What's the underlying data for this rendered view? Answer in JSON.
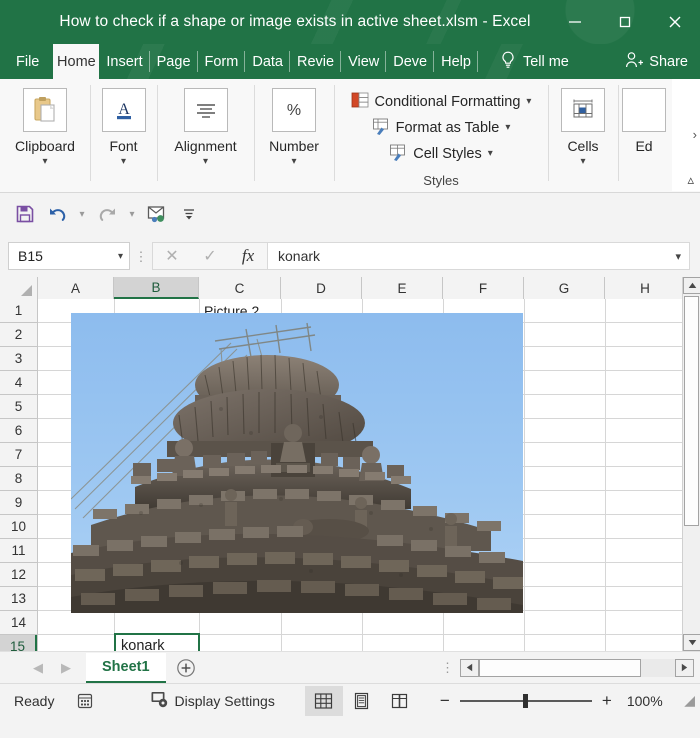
{
  "window": {
    "title": "How to check if a shape or image exists in active sheet.xlsm  -  Excel",
    "accent_green": "#217346",
    "controls": [
      {
        "name": "minimize",
        "glyph": "minimize-icon"
      },
      {
        "name": "maximize",
        "glyph": "maximize-icon"
      },
      {
        "name": "close",
        "glyph": "close-icon"
      }
    ]
  },
  "ribbon": {
    "tabs": [
      {
        "label": "File",
        "active": false
      },
      {
        "label": "Home",
        "active": true
      },
      {
        "label": "Insert",
        "active": false
      },
      {
        "label": "Page",
        "active": false
      },
      {
        "label": "Form",
        "active": false
      },
      {
        "label": "Data",
        "active": false
      },
      {
        "label": "Revie",
        "active": false
      },
      {
        "label": "View",
        "active": false
      },
      {
        "label": "Deve",
        "active": false
      },
      {
        "label": "Help",
        "active": false
      }
    ],
    "tell_me": "Tell me",
    "share": "Share",
    "groups": [
      {
        "label": "Clipboard",
        "icon": "clipboard-icon"
      },
      {
        "label": "Font",
        "icon": "font-a-icon"
      },
      {
        "label": "Alignment",
        "icon": "alignment-icon"
      },
      {
        "label": "Number",
        "icon": "percent-icon"
      }
    ],
    "styles": {
      "caption": "Styles",
      "items": [
        {
          "label": "Conditional Formatting",
          "icon": "conditional-formatting-icon"
        },
        {
          "label": "Format as Table",
          "icon": "format-as-table-icon"
        },
        {
          "label": "Cell Styles",
          "icon": "cell-styles-icon"
        }
      ]
    },
    "cells_group": {
      "label": "Cells",
      "icon": "cells-icon"
    },
    "editing_group": {
      "label": "Ed"
    }
  },
  "quick_access": [
    {
      "name": "save-icon"
    },
    {
      "name": "undo-icon"
    },
    {
      "name": "redo-icon"
    },
    {
      "name": "send-to-recipient-icon"
    },
    {
      "name": "customize-qat-icon"
    }
  ],
  "formula_bar": {
    "name_box_value": "B15",
    "cancel_label": "✕",
    "enter_label": "✓",
    "fx_label": "fx",
    "formula_value": "konark"
  },
  "grid": {
    "columns": [
      "A",
      "B",
      "C",
      "D",
      "E",
      "F",
      "G",
      "H"
    ],
    "selected_column": "B",
    "rows": [
      "1",
      "2",
      "3",
      "4",
      "5",
      "6",
      "7",
      "8",
      "9",
      "10",
      "11",
      "12",
      "13",
      "14",
      "15"
    ],
    "selected_row": "15",
    "cells": [
      {
        "ref": "C1",
        "value": "Picture 2"
      }
    ],
    "active_cell": {
      "ref": "B15",
      "value": "konark"
    },
    "picture": {
      "name": "Picture 2",
      "alt": "Konark Sun Temple stone carving against blue sky"
    }
  },
  "sheet_bar": {
    "tabs": [
      {
        "label": "Sheet1",
        "active": true
      }
    ],
    "add_sheet_label": "+"
  },
  "status_bar": {
    "state": "Ready",
    "accessibility_icon": "accessibility-checker-icon",
    "display_settings": "Display Settings",
    "views": [
      {
        "name": "normal-view",
        "icon": "grid-icon",
        "active": true
      },
      {
        "name": "page-layout-view",
        "icon": "page-layout-icon",
        "active": false
      },
      {
        "name": "page-break-view",
        "icon": "page-break-icon",
        "active": false
      }
    ],
    "zoom_out": "−",
    "zoom_in": "+",
    "zoom_level": "100%"
  }
}
